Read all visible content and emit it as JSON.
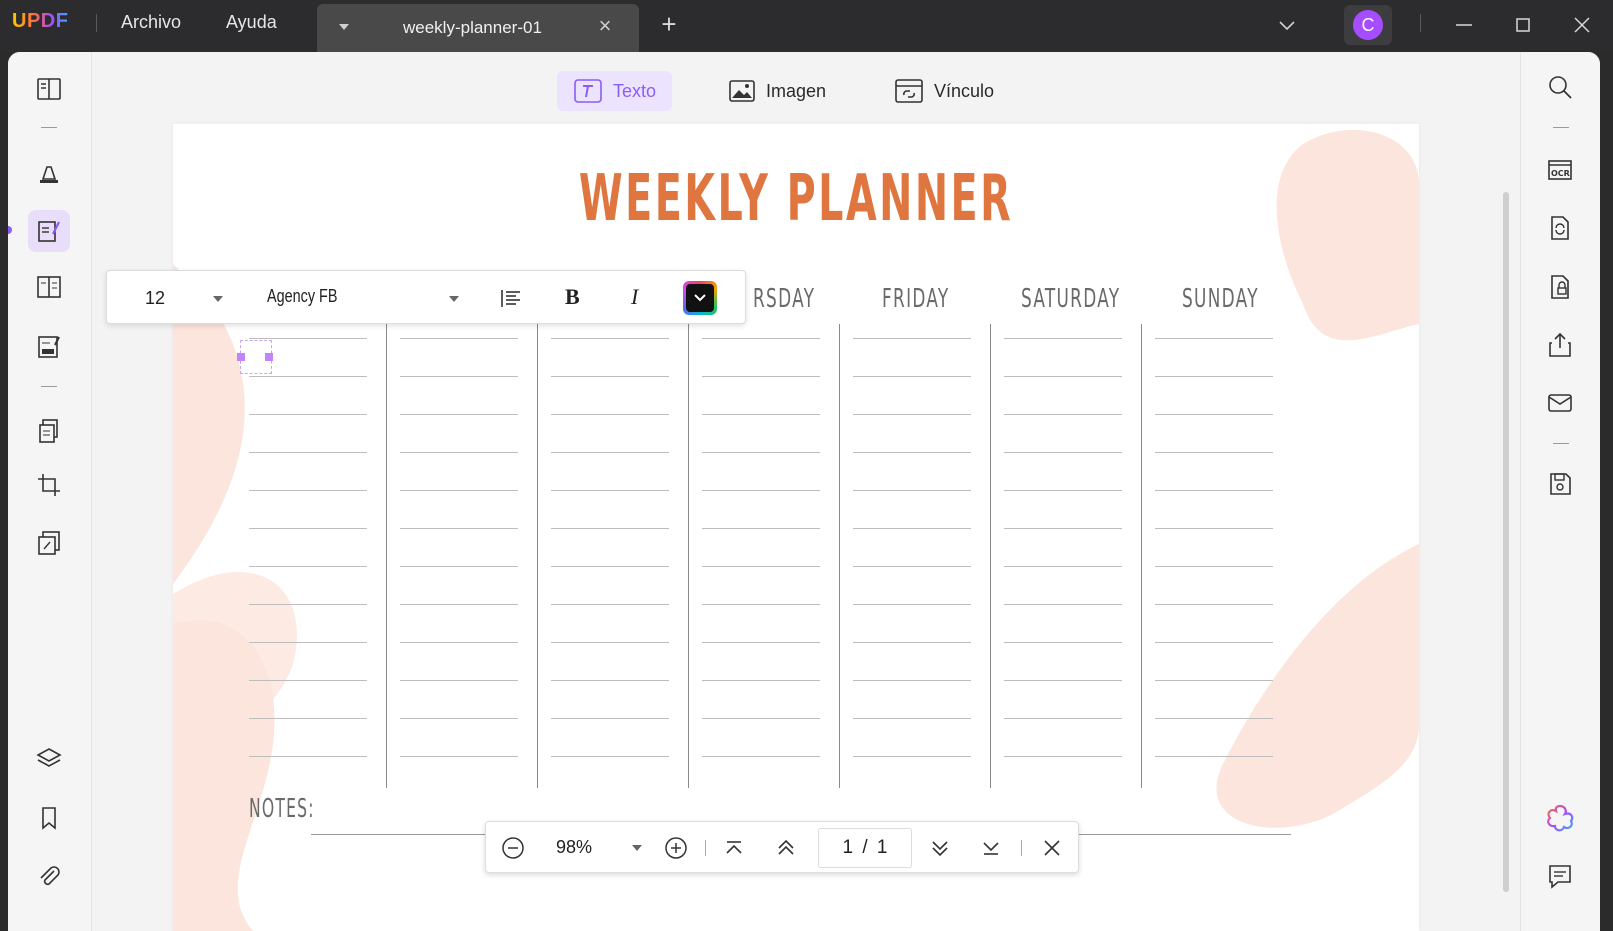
{
  "app": {
    "logo": "UPDF",
    "menu": [
      "Archivo",
      "Ayuda"
    ],
    "tab_title": "weekly-planner-01",
    "avatar_initial": "C",
    "colors": {
      "accent": "#8b5cf6",
      "title_orange": "#e0763f",
      "avatar": "#a64dff"
    }
  },
  "edit_toolbar": {
    "text_label": "Texto",
    "image_label": "Imagen",
    "link_label": "Vínculo"
  },
  "format_bar": {
    "font_size": "12",
    "font_name": "Agency FB",
    "bold_label": "B",
    "italic_label": "I"
  },
  "document": {
    "title": "WEEKLY PLANNER",
    "days_visible": [
      "RSDAY",
      "FRIDAY",
      "SATURDAY",
      "SUNDAY"
    ],
    "notes_label": "NOTES:"
  },
  "zoom_bar": {
    "zoom": "98%",
    "page_indicator": "1 / 1"
  },
  "icons": {
    "left_rail": [
      "reader-icon",
      "highlighter-icon",
      "edit-pdf-icon",
      "organize-icon",
      "fill-sign-icon",
      "pages-icon",
      "crop-icon",
      "stamp-icon",
      "layers-icon",
      "bookmark-icon",
      "attachment-icon"
    ],
    "right_rail": [
      "search-icon",
      "ocr-icon",
      "convert-icon",
      "protect-icon",
      "share-icon",
      "email-icon",
      "save-icon",
      "ai-assistant-icon",
      "comment-icon"
    ]
  }
}
